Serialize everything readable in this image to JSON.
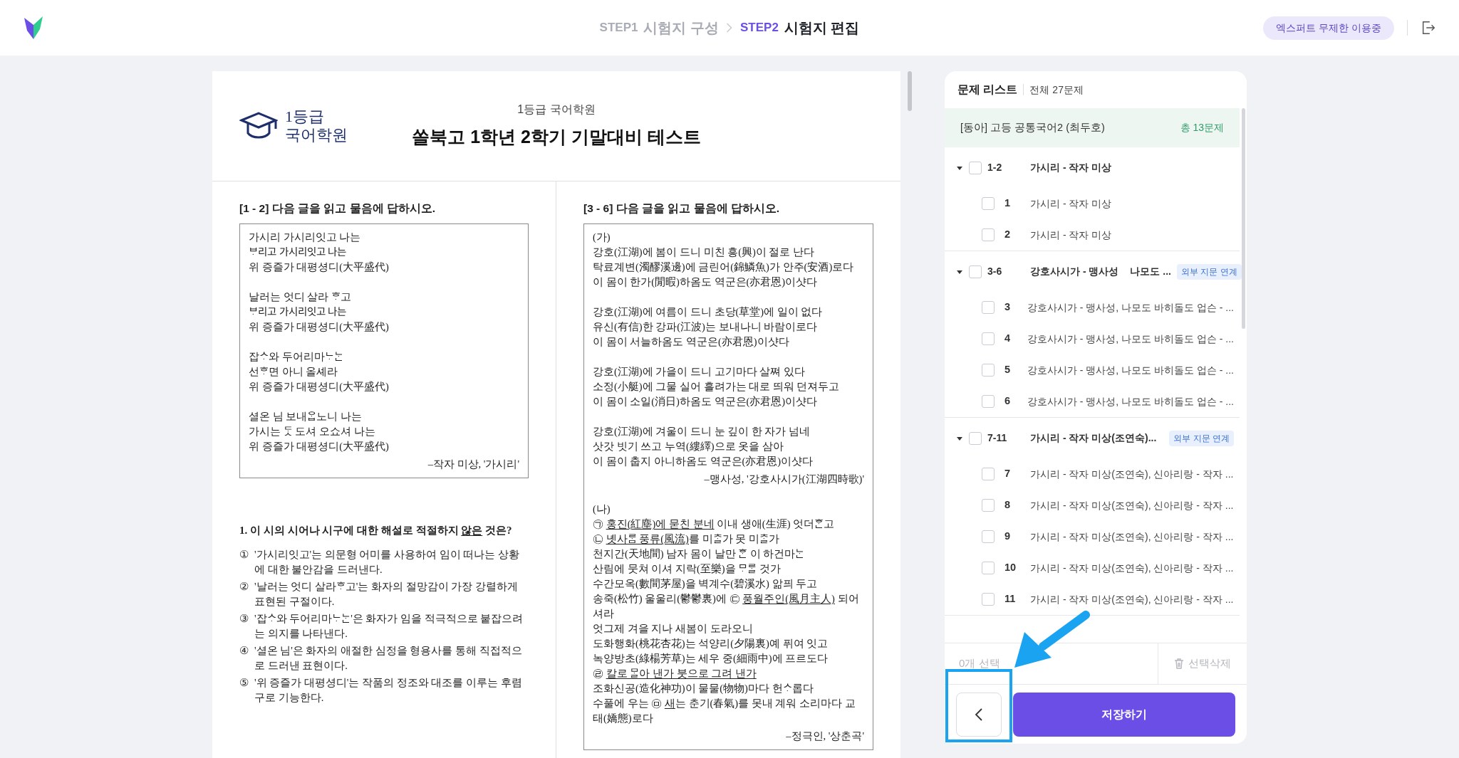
{
  "header": {
    "steps": [
      {
        "step": "STEP1",
        "label": "시험지 구성",
        "selected": false
      },
      {
        "step": "STEP2",
        "label": "시험지 편집",
        "selected": true
      }
    ],
    "plan_badge": "엑스퍼트 무제한 이용중"
  },
  "document": {
    "logo_text": [
      "1등급",
      "국어학원"
    ],
    "academy": "1등급 국어학원",
    "title": "쏠북고 1학년 2학기 기말대비 테스트",
    "columns": [
      {
        "heading": "[1 - 2] 다음 글을 읽고 물음에 답하시오.",
        "sections": [
          {
            "stanzas": [
              [
                "가시리 가시리잇고 나는",
                "ᄇᆞ리고 가시리잇고 나는",
                "위 증즐가 대평셩디(大平盛代)"
              ],
              [
                "날러는 엇디 살라 ᄒᆞ고",
                "ᄇᆞ리고 가시리잇고 나는",
                "위 증즐가 대평셩디(大平盛代)"
              ],
              [
                "잡ᄉᆞ와 두어리마ᄂᆞᄂᆞᆫ",
                "선ᄒᆞ면 아니 올셰라",
                "위 증즐가 대평셩디(大平盛代)"
              ],
              [
                "셜온 님 보내ᄋᆞᆸ노니 나는",
                "가시는 ᄃᆞᆺ 도셔 오쇼셔 나는",
                "위 증즐가 대평셩디(大平盛代)"
              ]
            ],
            "source": "–작자 미상, '가시리'"
          }
        ],
        "question": {
          "stem": [
            {
              "text": "1. 이 시의 시어나 시구에 대한 해설로 적절하지 ",
              "underline": false
            },
            {
              "text": "않은",
              "underline": true
            },
            {
              "text": " 것은?",
              "underline": false
            }
          ],
          "options": [
            {
              "mark": "①",
              "text": "'가시리잇고'는 의문형 어미를 사용하여 임이 떠나는 상황에 대한 불안감을 드러낸다."
            },
            {
              "mark": "②",
              "text": "'날러는 엇디 살라ᄒᆞ고'는 화자의 절망감이 가장 강렬하게 표현된 구절이다."
            },
            {
              "mark": "③",
              "text": "'잡ᄉᆞ와 두어리마ᄂᆞᄂᆞᆫ'은 화자가 임을 적극적으로 붙잡으려는 의지를 나타낸다."
            },
            {
              "mark": "④",
              "text": "'셜온 님'은 화자의 애절한 심정을 형용사를 통해 직접적으로 드러낸 표현이다."
            },
            {
              "mark": "⑤",
              "text": "'위 증즐가 대평셩디'는 작품의 정조와 대조를 이루는 후렴구로 기능한다."
            }
          ]
        }
      },
      {
        "heading": "[3 - 6] 다음 글을 읽고 물음에 답하시오.",
        "sections": [
          {
            "label": "(가)",
            "stanzas": [
              [
                "강호(江湖)에 봄이 드니 미친 흥(興)이 절로 난다",
                "탁료계변(濁醪溪邊)에 금린어(錦鱗魚)가 안주(安酒)로다",
                "이 몸이 한가(閒暇)하옴도 역군은(亦君恩)이샷다"
              ],
              [
                "강호(江湖)에 여름이 드니 초당(草堂)에 일이 없다",
                "유신(有信)한 강파(江波)는 보내나니 바람이로다",
                "이 몸이 서늘하옴도 역군은(亦君恩)이샷다"
              ],
              [
                "강호(江湖)에 가을이 드니 고기마다 살쪄 있다",
                "소정(小艇)에 그물 실어 흘려가는 대로 띄워 던져두고",
                "이 몸이 소일(消日)하옴도 역군은(亦君恩)이샷다"
              ],
              [
                "강호(江湖)에 겨울이 드니 눈 깊이 한 자가 넘네",
                "삿갓 빗기 쓰고 누역(縷繹)으로 옷을 삼아",
                "이 몸이 춥지 아니하옴도 역군은(亦君恩)이샷다"
              ]
            ],
            "source": "–맹사성, '강호사시가(江湖四時歌)'"
          },
          {
            "label": "(나)",
            "stanzas": [
              [
                [
                  {
                    "text": "㉠ ",
                    "underline": false
                  },
                  {
                    "text": "홍진(紅塵)에 묻친 분네",
                    "underline": true
                  },
                  {
                    "text": " 이내 생애(生涯) 엇더ᄒᆞᆫ고",
                    "underline": false
                  }
                ],
                [
                  {
                    "text": "㉡ ",
                    "underline": false
                  },
                  {
                    "text": "녯사ᄅᆞᆷ 풍류(風流)",
                    "underline": true
                  },
                  {
                    "text": "를 미ᄎᆞᆯ가 못 미ᄎᆞᆯ가",
                    "underline": false
                  }
                ],
                "천지간(天地間) 남자 몸이 날만 ᄒᆞᆫ 이 하건마ᄂᆞᆫ",
                "산림에 뭇쳐 이셔 지락(至樂)을 ᄆᆞᄅᆞᆯ 것가",
                "수간모옥(數間茅屋)을 벽계수(碧溪水) 앎픠 두고",
                [
                  {
                    "text": "송죽(松竹) 울울리(鬱鬱裏)에 ㉢ ",
                    "underline": false
                  },
                  {
                    "text": "풍월주인(風月主人)",
                    "underline": true
                  },
                  {
                    "text": " 되어셔라",
                    "underline": false
                  }
                ],
                "엇그제 겨을 지나 새봄이 도라오니",
                "도화행화(桃花杏花)는 석양리(夕陽裏)예 퓌여 잇고",
                "녹양방초(綠楊芳草)는 세우 중(細雨中)에 프르도다",
                [
                  {
                    "text": "㉣ ",
                    "underline": false
                  },
                  {
                    "text": "칼로 ᄆᆞᆯ아 낸가 붓으로 그려 낸가",
                    "underline": true
                  }
                ],
                "조화신공(造化神功)이 물물(物物)마다 헌ᄉᆞ롭다",
                [
                  {
                    "text": "수풀에 우는 ㉤ ",
                    "underline": false
                  },
                  {
                    "text": "새",
                    "underline": true
                  },
                  {
                    "text": "는 춘기(春氣)를 못내 계워 소리마다 교태(嬌態)로다",
                    "underline": false
                  }
                ]
              ]
            ],
            "source": "–정극인, '상춘곡'"
          }
        ]
      }
    ]
  },
  "question_list": {
    "title": "문제 리스트",
    "total": "전체 27문제",
    "book": {
      "title": "[동아] 고등 공통국어2 (최두호)",
      "count": "총 13문제"
    },
    "groups": [
      {
        "range": "1-2",
        "title": "가시리 - 작자 미상",
        "expanded": true,
        "checked": false,
        "items": [
          {
            "number": "1",
            "title": "가시리 - 작자 미상",
            "checked": false
          },
          {
            "number": "2",
            "title": "가시리 - 작자 미상",
            "checked": false
          }
        ]
      },
      {
        "range": "3-6",
        "title": "강호사시가 - 맹사성",
        "subtitle": "나모도 ...",
        "badge": "외부 지문 연계",
        "expanded": true,
        "checked": false,
        "items": [
          {
            "number": "3",
            "title": "강호사시가 - 맹사성, 나모도 바히돌도 업슨 - ...",
            "checked": false
          },
          {
            "number": "4",
            "title": "강호사시가 - 맹사성, 나모도 바히돌도 업슨 - ...",
            "checked": false
          },
          {
            "number": "5",
            "title": "강호사시가 - 맹사성, 나모도 바히돌도 업슨 - ...",
            "checked": false
          },
          {
            "number": "6",
            "title": "강호사시가 - 맹사성, 나모도 바히돌도 업슨 - ...",
            "checked": false
          }
        ]
      },
      {
        "range": "7-11",
        "title": "가시리 - 작자 미상(조연숙)...",
        "badge": "외부 지문 연계",
        "expanded": true,
        "checked": false,
        "items": [
          {
            "number": "7",
            "title": "가시리 - 작자 미상(조연숙), 신아리랑 - 작자 ...",
            "checked": false
          },
          {
            "number": "8",
            "title": "가시리 - 작자 미상(조연숙), 신아리랑 - 작자 ...",
            "checked": false
          },
          {
            "number": "9",
            "title": "가시리 - 작자 미상(조연숙), 신아리랑 - 작자 ...",
            "checked": false
          },
          {
            "number": "10",
            "title": "가시리 - 작자 미상(조연숙), 신아리랑 - 작자 ...",
            "checked": false
          },
          {
            "number": "11",
            "title": "가시리 - 작자 미상(조연숙), 신아리랑 - 작자 ...",
            "checked": false
          }
        ]
      }
    ],
    "selected_count": "0개 선택",
    "delete_label": "선택삭제",
    "delete_disabled": true,
    "save_label": "저장하기"
  }
}
